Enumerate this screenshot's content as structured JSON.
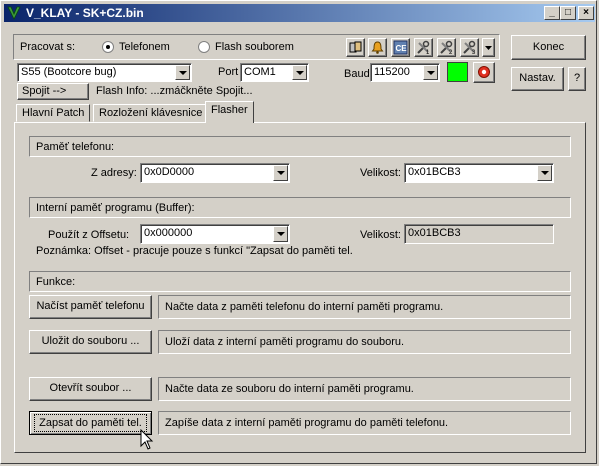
{
  "window": {
    "title": "V_KLAY - SK+CZ.bin",
    "min_btn": "_",
    "max_btn": "□",
    "close_btn": "×"
  },
  "top": {
    "work_with_label": "Pracovat s:",
    "radio_phone": "Telefonem",
    "radio_file": "Flash souborem",
    "model_value": "S55 (Bootcore bug)",
    "port_label": "Port",
    "port_value": "COM1",
    "baud_label": "Baud",
    "baud_value": "115200",
    "connect_label": "Spojit -->",
    "flash_info": "Flash Info: ...zmáčkněte Spojit...",
    "konec_label": "Konec",
    "nastav_label": "Nastav.",
    "help_label": "?",
    "status_color": "#00ff00",
    "toolbar_icons": [
      "phone-book-icon",
      "bell-icon",
      "ce-chip-icon",
      "tools-1-icon",
      "tools-2-icon",
      "tools-3-icon"
    ]
  },
  "tabs": [
    "Hlavní Patch",
    "Rozložení klávesnice",
    "Flasher"
  ],
  "flasher": {
    "phone_mem_title": "Paměť telefonu:",
    "from_addr_label": "Z adresy:",
    "from_addr_value": "0x0D0000",
    "size_label": "Velikost:",
    "size_value": "0x01BCB3",
    "buffer_title": "Interní paměť programu (Buffer):",
    "offset_label": "Použít z Offsetu:",
    "offset_value": "0x000000",
    "size2_label": "Velikost:",
    "size2_value": "0x01BCB3",
    "note": "Poznámka: Offset - pracuje pouze s funkcí \"Zapsat do paměti tel.",
    "functions_title": "Funkce:",
    "actions": [
      {
        "button": "Načíst paměť telefonu",
        "desc": "Načte data z paměti telefonu do interní paměti programu."
      },
      {
        "button": "Uložit do souboru ...",
        "desc": "Uloží data z interní paměti programu do souboru."
      },
      {
        "button": "Otevřít soubor ...",
        "desc": "Načte data ze souboru do interní paměti programu."
      },
      {
        "button": "Zapsat do paměti tel.",
        "desc": "Zapíše data z interní paměti programu do paměti telefonu."
      }
    ]
  }
}
